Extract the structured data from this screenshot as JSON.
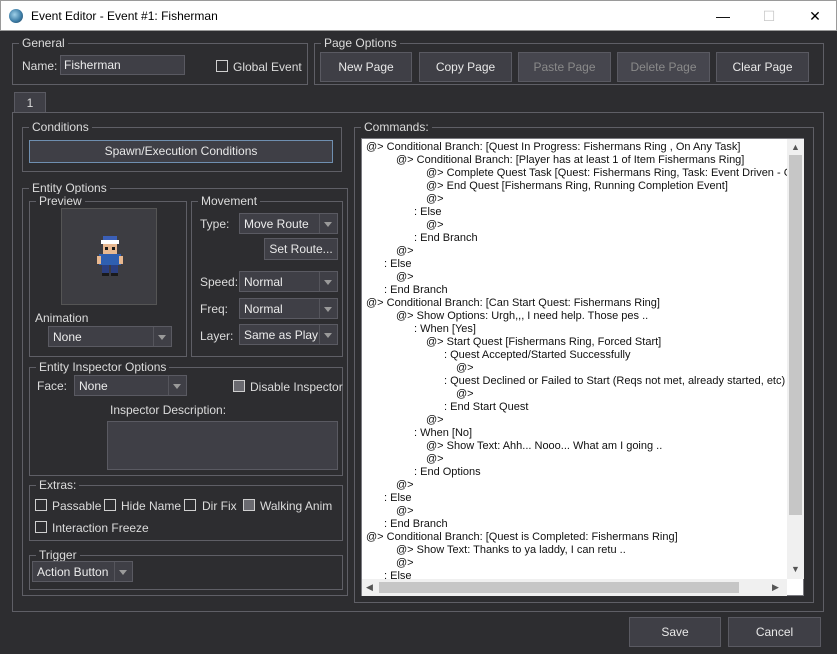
{
  "window": {
    "title": "Event Editor - Event #1: Fisherman",
    "minimize_glyph": "—",
    "maximize_glyph": "☐",
    "close_glyph": "✕"
  },
  "general": {
    "label": "General",
    "name_label": "Name:",
    "name_value": "Fisherman",
    "global_event_label": "Global Event"
  },
  "page_options": {
    "label": "Page Options",
    "buttons": [
      "New Page",
      "Copy Page",
      "Paste Page",
      "Delete Page",
      "Clear Page"
    ]
  },
  "tabs": [
    "1"
  ],
  "conditions": {
    "label": "Conditions",
    "spawn_button": "Spawn/Execution Conditions"
  },
  "entity_options": {
    "label": "Entity Options",
    "preview_label": "Preview",
    "animation_label": "Animation",
    "animation_value": "None",
    "movement": {
      "label": "Movement",
      "type_label": "Type:",
      "type_value": "Move Route",
      "set_route_button": "Set Route...",
      "speed_label": "Speed:",
      "speed_value": "Normal",
      "freq_label": "Freq:",
      "freq_value": "Normal",
      "layer_label": "Layer:",
      "layer_value": "Same as Play"
    }
  },
  "inspector": {
    "label": "Entity Inspector Options",
    "face_label": "Face:",
    "face_value": "None",
    "disable_label": "Disable Inspector",
    "description_label": "Inspector Description:"
  },
  "extras": {
    "label": "Extras:",
    "passable": "Passable",
    "hide_name": "Hide Name",
    "dir_fix": "Dir Fix",
    "walking_anim": "Walking Anim",
    "interaction_freeze": "Interaction Freeze"
  },
  "trigger": {
    "label": "Trigger",
    "value": "Action Button"
  },
  "commands": {
    "label": "Commands:",
    "lines": [
      {
        "indent": 0,
        "text": "@> Conditional Branch: [Quest In Progress: Fishermans Ring , On Any Task]"
      },
      {
        "indent": 1,
        "text": "@> Conditional Branch: [Player has at least 1 of Item Fishermans Ring]"
      },
      {
        "indent": 2,
        "text": "@> Complete Quest Task [Quest: Fishermans Ring, Task: Event Driven - Ge"
      },
      {
        "indent": 2,
        "text": "@> End Quest [Fishermans Ring, Running Completion Event]"
      },
      {
        "indent": 2,
        "text": "@>"
      },
      {
        "indent": 1.6,
        "text": ": Else"
      },
      {
        "indent": 2,
        "text": "@>"
      },
      {
        "indent": 1.6,
        "text": ": End Branch"
      },
      {
        "indent": 1,
        "text": "@>"
      },
      {
        "indent": 0.6,
        "text": ": Else"
      },
      {
        "indent": 1,
        "text": "@>"
      },
      {
        "indent": 0.6,
        "text": ": End Branch"
      },
      {
        "indent": 0,
        "text": "@> Conditional Branch: [Can Start Quest: Fishermans Ring]"
      },
      {
        "indent": 1,
        "text": "@> Show Options: Urgh,,, I need help. Those pes .."
      },
      {
        "indent": 1.6,
        "text": ": When [Yes]"
      },
      {
        "indent": 2,
        "text": "@> Start Quest [Fishermans Ring, Forced Start]"
      },
      {
        "indent": 2.6,
        "text": ": Quest Accepted/Started Successfully"
      },
      {
        "indent": 3,
        "text": "@>"
      },
      {
        "indent": 2.6,
        "text": ": Quest Declined or Failed to Start (Reqs not met, already started, etc)"
      },
      {
        "indent": 3,
        "text": "@>"
      },
      {
        "indent": 2.6,
        "text": ": End Start Quest"
      },
      {
        "indent": 2,
        "text": "@>"
      },
      {
        "indent": 1.6,
        "text": ": When [No]"
      },
      {
        "indent": 2,
        "text": "@> Show Text: Ahh... Nooo... What am I going .."
      },
      {
        "indent": 2,
        "text": "@>"
      },
      {
        "indent": 1.6,
        "text": ": End Options"
      },
      {
        "indent": 1,
        "text": "@>"
      },
      {
        "indent": 0.6,
        "text": ": Else"
      },
      {
        "indent": 1,
        "text": "@>"
      },
      {
        "indent": 0.6,
        "text": ": End Branch"
      },
      {
        "indent": 0,
        "text": "@> Conditional Branch: [Quest is Completed: Fishermans Ring]"
      },
      {
        "indent": 1,
        "text": "@> Show Text: Thanks to ya laddy, I can retu .."
      },
      {
        "indent": 1,
        "text": "@>"
      },
      {
        "indent": 0.6,
        "text": ": Else"
      }
    ]
  },
  "footer": {
    "save": "Save",
    "cancel": "Cancel"
  }
}
